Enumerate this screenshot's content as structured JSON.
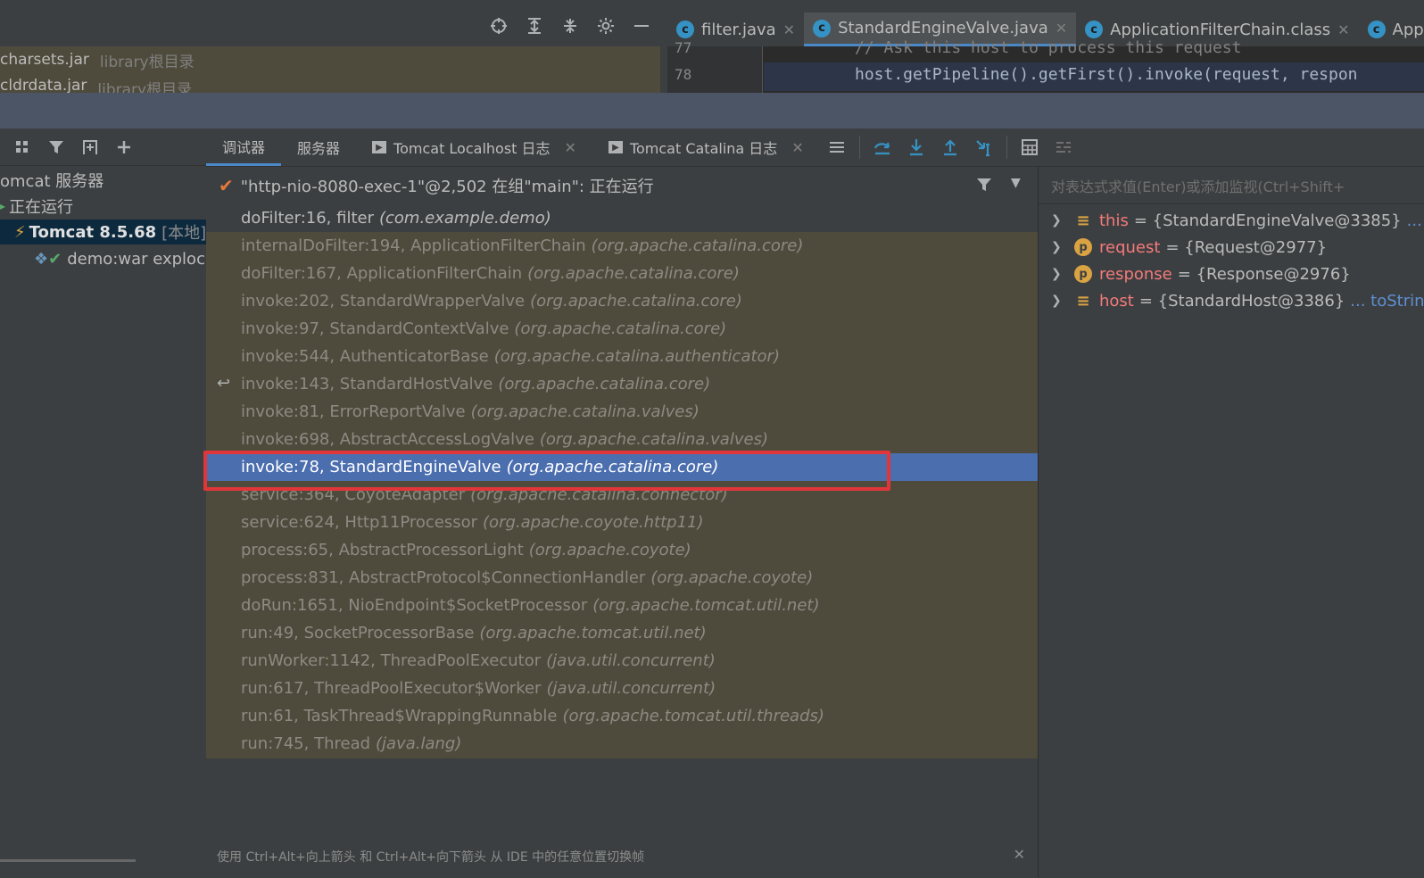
{
  "project": {
    "libs": [
      {
        "name": "charsets.jar",
        "desc": "library根目录"
      },
      {
        "name": "cldrdata.jar",
        "desc": "library根目录"
      }
    ]
  },
  "editor": {
    "tabs": [
      {
        "label": "filter.java",
        "active": false
      },
      {
        "label": "StandardEngineValve.java",
        "active": true
      },
      {
        "label": "ApplicationFilterChain.class",
        "active": false
      },
      {
        "label": "App",
        "active": false
      }
    ],
    "lines": [
      {
        "num": "77",
        "code": "// Ask this host to process this request"
      },
      {
        "num": "78",
        "code": "host.getPipeline().getFirst().invoke(request, respon"
      }
    ]
  },
  "services": {
    "tree": {
      "group": "omcat 服务器",
      "status": "正在运行",
      "server": "Tomcat 8.5.68",
      "server_tag": "[本地]",
      "artifact": "demo:war exploc"
    }
  },
  "debugger": {
    "tabs": {
      "debugger": "调试器",
      "server": "服务器",
      "localhost_log": "Tomcat Localhost 日志",
      "catalina_log": "Tomcat Catalina 日志"
    },
    "thread": "\"http-nio-8080-exec-1\"@2,502 在组\"main\": 正在运行",
    "frames": [
      {
        "method": "doFilter:16, filter",
        "pkg": "(com.example.demo)"
      },
      {
        "method": "internalDoFilter:194, ApplicationFilterChain",
        "pkg": "(org.apache.catalina.core)"
      },
      {
        "method": "doFilter:167, ApplicationFilterChain",
        "pkg": "(org.apache.catalina.core)"
      },
      {
        "method": "invoke:202, StandardWrapperValve",
        "pkg": "(org.apache.catalina.core)"
      },
      {
        "method": "invoke:97, StandardContextValve",
        "pkg": "(org.apache.catalina.core)"
      },
      {
        "method": "invoke:544, AuthenticatorBase",
        "pkg": "(org.apache.catalina.authenticator)"
      },
      {
        "method": "invoke:143, StandardHostValve",
        "pkg": "(org.apache.catalina.core)"
      },
      {
        "method": "invoke:81, ErrorReportValve",
        "pkg": "(org.apache.catalina.valves)"
      },
      {
        "method": "invoke:698, AbstractAccessLogValve",
        "pkg": "(org.apache.catalina.valves)"
      },
      {
        "method": "invoke:78, StandardEngineValve",
        "pkg": "(org.apache.catalina.core)"
      },
      {
        "method": "service:364, CoyoteAdapter",
        "pkg": "(org.apache.catalina.connector)"
      },
      {
        "method": "service:624, Http11Processor",
        "pkg": "(org.apache.coyote.http11)"
      },
      {
        "method": "process:65, AbstractProcessorLight",
        "pkg": "(org.apache.coyote)"
      },
      {
        "method": "process:831, AbstractProtocol$ConnectionHandler",
        "pkg": "(org.apache.coyote)"
      },
      {
        "method": "doRun:1651, NioEndpoint$SocketProcessor",
        "pkg": "(org.apache.tomcat.util.net)"
      },
      {
        "method": "run:49, SocketProcessorBase",
        "pkg": "(org.apache.tomcat.util.net)"
      },
      {
        "method": "runWorker:1142, ThreadPoolExecutor",
        "pkg": "(java.util.concurrent)"
      },
      {
        "method": "run:617, ThreadPoolExecutor$Worker",
        "pkg": "(java.util.concurrent)"
      },
      {
        "method": "run:61, TaskThread$WrappingRunnable",
        "pkg": "(org.apache.tomcat.util.threads)"
      },
      {
        "method": "run:745, Thread",
        "pkg": "(java.lang)"
      }
    ],
    "hint": "使用 Ctrl+Alt+向上箭头 和 Ctrl+Alt+向下箭头 从 IDE 中的任意位置切换帧"
  },
  "variables": {
    "placeholder": "对表达式求值(Enter)或添加监视(Ctrl+Shift+",
    "items": [
      {
        "name": "this",
        "value": "= {StandardEngineValve@3385}",
        "extra": "... t",
        "kind": "field"
      },
      {
        "name": "request",
        "value": "= {Request@2977}",
        "extra": "",
        "kind": "param"
      },
      {
        "name": "response",
        "value": "= {Response@2976}",
        "extra": "",
        "kind": "param"
      },
      {
        "name": "host",
        "value": "= {StandardHost@3386}",
        "extra": "... toStrin",
        "kind": "field"
      }
    ]
  },
  "colors": {
    "accent": "#4a88c7",
    "selection": "#4b6eaf",
    "highlight_box": "#e0363a",
    "frames_bg": "#4f4b3c"
  }
}
